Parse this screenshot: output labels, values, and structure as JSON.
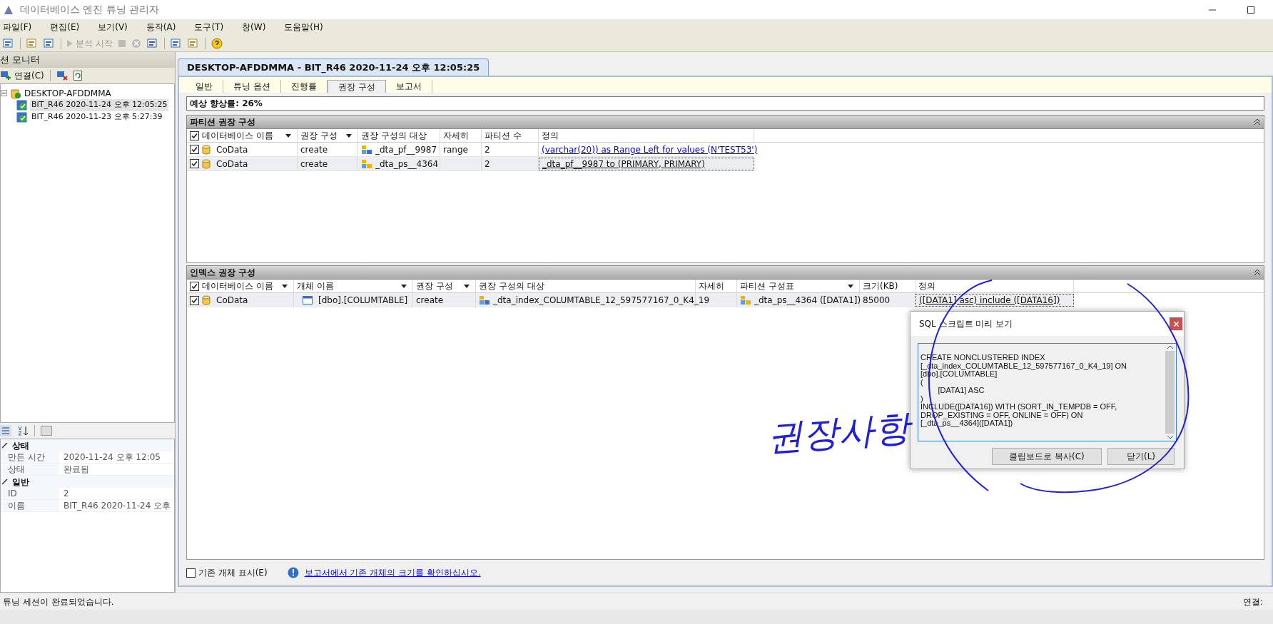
{
  "window": {
    "title": "데이터베이스 엔진 튜닝 관리자"
  },
  "menu": [
    "파일(F)",
    "편집(E)",
    "보기(V)",
    "동작(A)",
    "도구(T)",
    "창(W)",
    "도움말(H)"
  ],
  "toolbar": {
    "start_analysis": {
      "label": "분석 시작",
      "disabled": true
    }
  },
  "session_monitor": {
    "title": "션 모니터",
    "connect_label": "연결(C)",
    "tree": [
      {
        "label": "DESKTOP-AFDDMMA",
        "expanded": true,
        "children": [
          {
            "label": "BIT_R46 2020-11-24 오후 12:05:25",
            "selected": true
          },
          {
            "label": "BIT_R46 2020-11-23 오후 5:27:39",
            "selected": false
          }
        ]
      }
    ],
    "properties": [
      {
        "title": "상태",
        "expanded": true,
        "rows": [
          {
            "name": "만든 시간",
            "value": "2020-11-24 오후 12:05"
          },
          {
            "name": "상태",
            "value": "완료됨"
          }
        ]
      },
      {
        "title": "일반",
        "expanded": true,
        "rows": [
          {
            "name": "ID",
            "value": "2"
          },
          {
            "name": "이름",
            "value": "BIT_R46 2020-11-24 오후"
          }
        ]
      }
    ]
  },
  "document_tab": "DESKTOP-AFDDMMA - BIT_R46 2020-11-24 오후 12:05:25",
  "tabs": [
    {
      "label": "일반",
      "selected": false
    },
    {
      "label": "튜닝 옵션",
      "selected": false
    },
    {
      "label": "진행률",
      "selected": false
    },
    {
      "label": "권장 구성",
      "selected": true
    },
    {
      "label": "보고서",
      "selected": false
    }
  ],
  "estimate": "예상 향상률: 26%",
  "partition_section": {
    "title": "파티션 권장 구성",
    "all_checked": true,
    "columns": [
      {
        "label": "데이터베이스 이름",
        "dropdown": true
      },
      {
        "label": "권장 구성",
        "dropdown": true
      },
      {
        "label": "권장 구성의 대상",
        "dropdown": false
      },
      {
        "label": "자세히",
        "dropdown": false
      },
      {
        "label": "파티션 수",
        "dropdown": false
      },
      {
        "label": "정의",
        "dropdown": false
      }
    ],
    "rows": [
      {
        "checked": true,
        "selected": false,
        "database": "CoData",
        "action": "create",
        "target": {
          "text": "_dta_pf__9987",
          "kind": "function"
        },
        "detail": "range",
        "count": "2",
        "definition": {
          "text": "(varchar(20)) as Range Left for values (N'TEST53')",
          "kind": "link"
        }
      },
      {
        "checked": true,
        "selected": true,
        "database": "CoData",
        "action": "create",
        "target": {
          "text": "_dta_ps__4364",
          "kind": "scheme"
        },
        "detail": "",
        "count": "2",
        "definition": {
          "text": "_dta_pf__9987 to (PRIMARY, PRIMARY)",
          "kind": "focused"
        }
      }
    ]
  },
  "index_section": {
    "title": "인덱스 권장 구성",
    "all_checked": true,
    "columns": [
      {
        "label": "데이터베이스 이름",
        "dropdown": true
      },
      {
        "label": "개체 이름",
        "dropdown": true
      },
      {
        "label": "권장 구성",
        "dropdown": true
      },
      {
        "label": "권장 구성의 대상",
        "dropdown": false
      },
      {
        "label": "자세히",
        "dropdown": false
      },
      {
        "label": "파티션 구성표",
        "dropdown": true
      },
      {
        "label": "크기(KB)",
        "dropdown": false
      },
      {
        "label": "정의",
        "dropdown": false
      }
    ],
    "rows": [
      {
        "checked": true,
        "selected": true,
        "database": "CoData",
        "object": "[dbo].[COLUMTABLE]",
        "action": "create",
        "target": "_dta_index_COLUMTABLE_12_597577167_0_K4_19",
        "detail": "",
        "scheme": "_dta_ps__4364 ([DATA1])",
        "size": "85000",
        "definition": {
          "text": "([DATA1] asc) include ([DATA16])",
          "kind": "focused"
        }
      }
    ]
  },
  "show_existing": {
    "label": "기존 개체 표시(E)",
    "checked": false
  },
  "report_link": "보고서에서 기존 개체의 크기를 확인하십시오.",
  "dialog": {
    "title": "SQL 스크립트 미리 보기",
    "script": "CREATE NONCLUSTERED INDEX\n[_dta_index_COLUMTABLE_12_597577167_0_K4_19] ON\n[dbo].[COLUMTABLE]\n(\n\t[DATA1] ASC\n)\nINCLUDE([DATA16]) WITH (SORT_IN_TEMPDB = OFF,\nDROP_EXISTING = OFF, ONLINE = OFF) ON\n[_dta_ps__4364]([DATA1])",
    "buttons": [
      "클립보드로 복사(C)",
      "닫기(L)"
    ]
  },
  "annotation": "권장사항",
  "status_bar": {
    "message": "튜닝 세션이 완료되었습니다.",
    "right": "연결:"
  }
}
